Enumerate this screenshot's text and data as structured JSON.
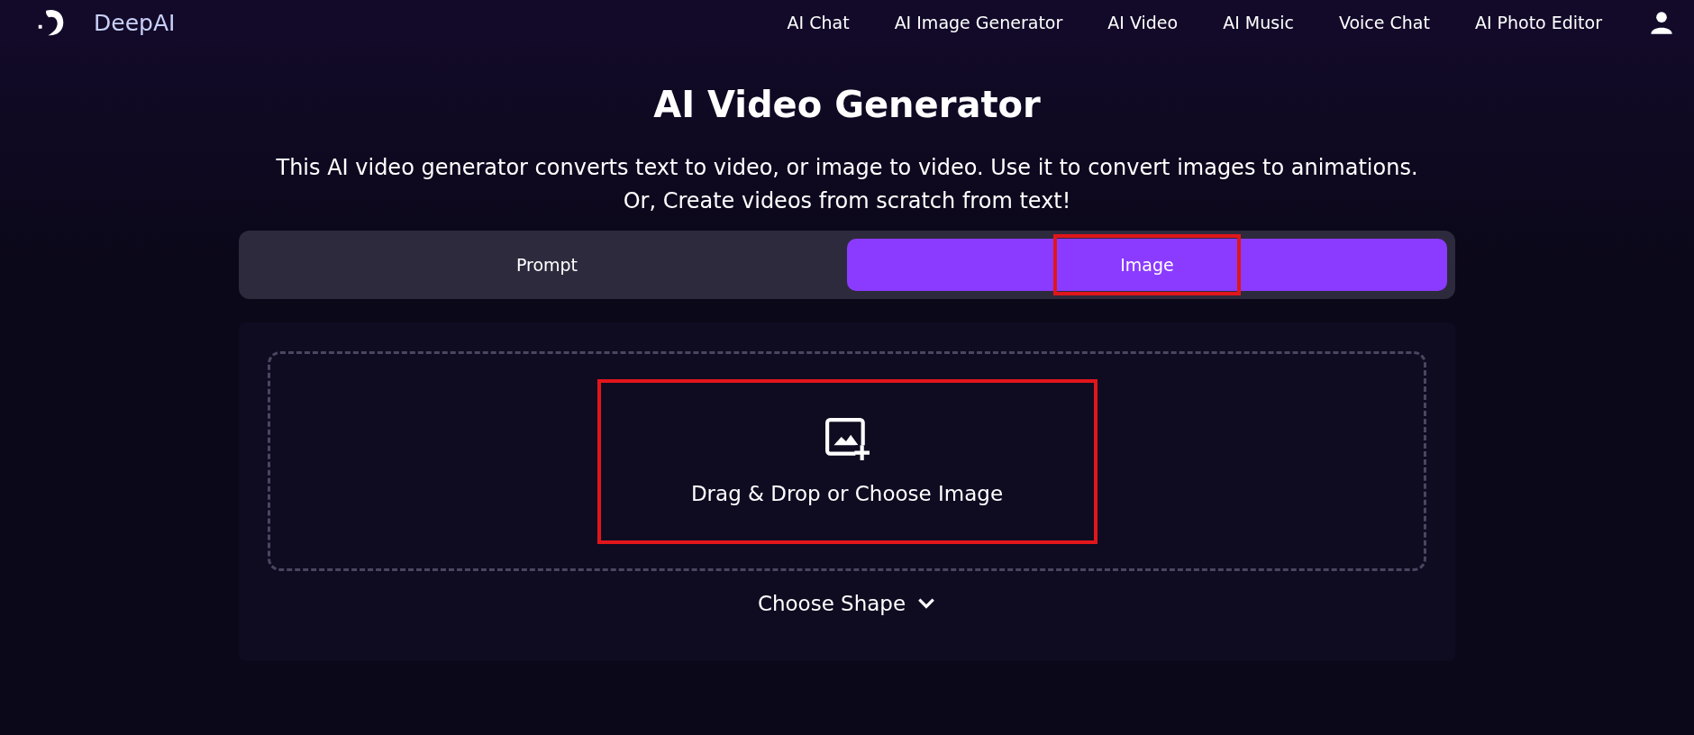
{
  "header": {
    "brand": "DeepAI",
    "nav": [
      "AI Chat",
      "AI Image Generator",
      "AI Video",
      "AI Music",
      "Voice Chat",
      "AI Photo Editor"
    ]
  },
  "title": "AI Video Generator",
  "description": "This AI video generator converts text to video, or image to video. Use it to convert images to animations. Or, Create videos from scratch from text!",
  "tabs": [
    {
      "label": "Prompt",
      "selected": false,
      "highlighted": false
    },
    {
      "label": "Image",
      "selected": true,
      "highlighted": true
    }
  ],
  "upload": {
    "label": "Drag & Drop or Choose Image",
    "highlighted": true
  },
  "shape_toggle": {
    "label": "Choose Shape",
    "expanded": false
  }
}
